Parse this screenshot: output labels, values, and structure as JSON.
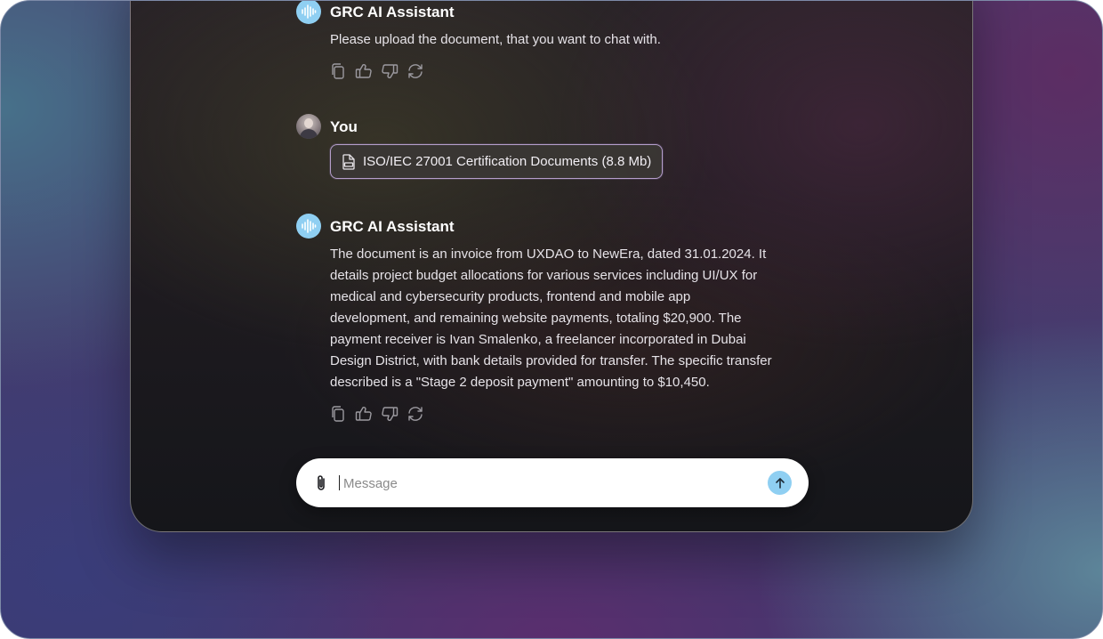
{
  "messages": [
    {
      "sender": "GRC AI Assistant",
      "text": "Please upload the document, that you want to chat with."
    },
    {
      "sender": "You",
      "attachment": {
        "name": "ISO/IEC 27001 Certification Documents (8.8 Mb)",
        "icon": "pdf-file-icon"
      }
    },
    {
      "sender": "GRC AI Assistant",
      "text_lines": [
        "The document is an invoice from UXDAO to NewEra, dated 31.01.2024. It",
        "details project budget allocations for various services including UI/UX for",
        "medical and cybersecurity products, frontend and mobile app",
        "development, and remaining website payments, totaling $20,900. The",
        "payment receiver is Ivan Smalenko, a freelancer incorporated in Dubai",
        "Design District, with bank details provided for transfer. The specific transfer",
        "described is a \"Stage 2 deposit payment\" amounting to $10,450."
      ]
    }
  ],
  "message_actions": [
    "copy-icon",
    "thumbs-up-icon",
    "thumbs-down-icon",
    "regenerate-icon"
  ],
  "composer": {
    "placeholder": "Message",
    "attach_icon": "paperclip-icon",
    "send_icon": "arrow-up-icon"
  },
  "colors": {
    "accent": "#8fcff2",
    "panel_bg": "#1d1a1f",
    "chip_border": "#b59ecb"
  }
}
